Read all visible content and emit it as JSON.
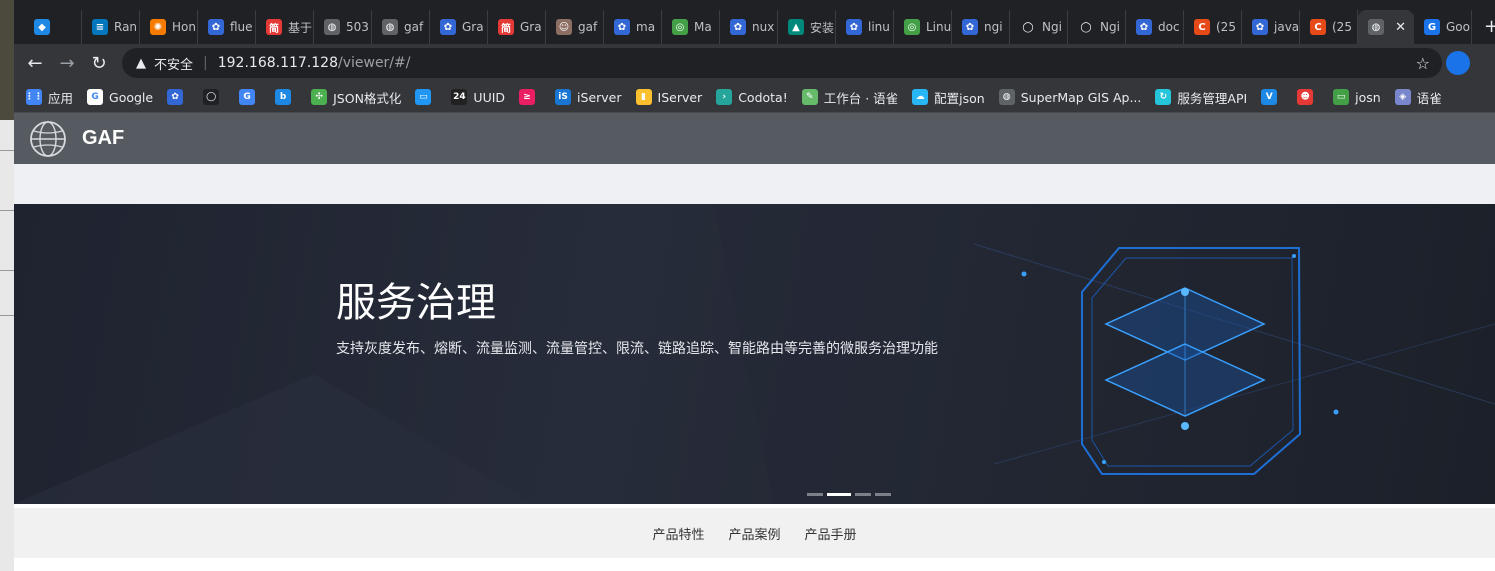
{
  "browser": {
    "tabs": [
      {
        "label": "",
        "color": "#1e88e5",
        "glyph": "◆"
      },
      {
        "label": "Ran",
        "color": "#0277bd",
        "glyph": "≡"
      },
      {
        "label": "Hon",
        "color": "#f57c00",
        "glyph": "✺"
      },
      {
        "label": "flue",
        "color": "#3367d6",
        "glyph": "✿"
      },
      {
        "label": "基于",
        "color": "#e53935",
        "glyph": "简"
      },
      {
        "label": "503",
        "color": "#5f6368",
        "glyph": "◍"
      },
      {
        "label": "gaf",
        "color": "#5f6368",
        "glyph": "◍"
      },
      {
        "label": "Gra",
        "color": "#3367d6",
        "glyph": "✿"
      },
      {
        "label": "Gra",
        "color": "#e53935",
        "glyph": "简"
      },
      {
        "label": "gaf",
        "color": "#8d6e63",
        "glyph": "☺"
      },
      {
        "label": "ma",
        "color": "#3367d6",
        "glyph": "✿"
      },
      {
        "label": "Ma",
        "color": "#43a047",
        "glyph": "◎"
      },
      {
        "label": "nux",
        "color": "#3367d6",
        "glyph": "✿"
      },
      {
        "label": "安装",
        "color": "#00897b",
        "glyph": "▲"
      },
      {
        "label": "linu",
        "color": "#3367d6",
        "glyph": "✿"
      },
      {
        "label": "Linu",
        "color": "#43a047",
        "glyph": "◎"
      },
      {
        "label": "ngi",
        "color": "#3367d6",
        "glyph": "✿"
      },
      {
        "label": "Ngi",
        "color": "#202124",
        "glyph": "◯"
      },
      {
        "label": "Ngi",
        "color": "#202124",
        "glyph": "◯"
      },
      {
        "label": "doc",
        "color": "#3367d6",
        "glyph": "✿"
      },
      {
        "label": "(25",
        "color": "#e64a19",
        "glyph": "C"
      },
      {
        "label": "java",
        "color": "#3367d6",
        "glyph": "✿"
      },
      {
        "label": "(25",
        "color": "#e64a19",
        "glyph": "C"
      },
      {
        "label": "",
        "color": "#5f6368",
        "glyph": "◍",
        "active": true
      },
      {
        "label": "Goo",
        "color": "#1a73e8",
        "glyph": "G"
      }
    ],
    "active_close": "✕",
    "new_tab": "+",
    "back": "←",
    "forward": "→",
    "reload": "↻",
    "security_icon": "▲",
    "security_label": "不安全",
    "url_host": "192.168.117.128",
    "url_path": "/viewer/#/",
    "bookmark_star": "☆",
    "bookmarks": [
      {
        "label": "应用",
        "color": "#4285f4",
        "glyph": "⋮⋮"
      },
      {
        "label": "Google",
        "color": "#ffffff",
        "glyph": "G"
      },
      {
        "label": "",
        "color": "#3367d6",
        "glyph": "✿"
      },
      {
        "label": "",
        "color": "#202124",
        "glyph": "◯"
      },
      {
        "label": "",
        "color": "#4285f4",
        "glyph": "G"
      },
      {
        "label": "",
        "color": "#1e88e5",
        "glyph": "b"
      },
      {
        "label": "JSON格式化",
        "color": "#4caf50",
        "glyph": "✣"
      },
      {
        "label": "",
        "color": "#2196f3",
        "glyph": "▭"
      },
      {
        "label": "UUID",
        "color": "#212121",
        "glyph": "24"
      },
      {
        "label": "",
        "color": "#e91e63",
        "glyph": "≥"
      },
      {
        "label": "iServer",
        "color": "#1976d2",
        "glyph": "iS"
      },
      {
        "label": "IServer",
        "color": "#fbc02d",
        "glyph": "▮"
      },
      {
        "label": "Codota!",
        "color": "#26a69a",
        "glyph": "›"
      },
      {
        "label": "工作台 · 语雀",
        "color": "#66bb6a",
        "glyph": "✎"
      },
      {
        "label": "配置json",
        "color": "#29b6f6",
        "glyph": "☁"
      },
      {
        "label": "SuperMap GIS Ap...",
        "color": "#5f6368",
        "glyph": "◍"
      },
      {
        "label": "服务管理API",
        "color": "#26c6da",
        "glyph": "↻"
      },
      {
        "label": "",
        "color": "#1e88e5",
        "glyph": "V"
      },
      {
        "label": "",
        "color": "#e53935",
        "glyph": "☻"
      },
      {
        "label": "josn",
        "color": "#43a047",
        "glyph": "▭"
      },
      {
        "label": "语雀",
        "color": "#7986cb",
        "glyph": "◈"
      }
    ]
  },
  "app": {
    "brand": "GAF",
    "banner": {
      "title": "服务治理",
      "subtitle": "支持灰度发布、熔断、流量监测、流量管控、限流、链路追踪、智能路由等完善的微服务治理功能"
    },
    "carousel_dots": 4,
    "carousel_active": 1,
    "footer_links": [
      "产品特性",
      "产品案例",
      "产品手册"
    ]
  }
}
